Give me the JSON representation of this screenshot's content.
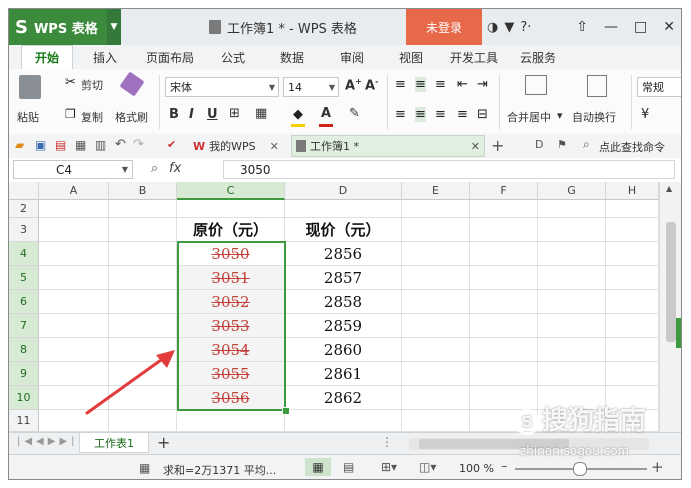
{
  "app": {
    "name": "WPS 表格",
    "logo_letter": "S",
    "doc_title": "工作簿1 * - WPS 表格",
    "login_label": "未登录"
  },
  "menu_tabs": [
    "开始",
    "插入",
    "页面布局",
    "公式",
    "数据",
    "审阅",
    "视图",
    "开发工具",
    "云服务"
  ],
  "ribbon": {
    "paste": "粘贴",
    "cut": "剪切",
    "copy": "复制",
    "format_painter": "格式刷",
    "font": "宋体",
    "font_size": "14",
    "merge_center": "合并居中",
    "wrap_text": "自动换行",
    "number_format": "常规"
  },
  "doc_tabs": {
    "my_wps": "我的WPS",
    "workbook": "工作簿1 *",
    "search": "点此查找命令"
  },
  "formula_bar": {
    "name_box": "C4",
    "fx": "fx",
    "value": "3050"
  },
  "columns": [
    "A",
    "B",
    "C",
    "D",
    "E",
    "F",
    "G",
    "H"
  ],
  "rows": [
    "2",
    "3",
    "4",
    "5",
    "6",
    "7",
    "8",
    "9",
    "10",
    "11"
  ],
  "table": {
    "header_original": "原价（元）",
    "header_current": "现价（元）",
    "original_prices": [
      "3050",
      "3051",
      "3052",
      "3053",
      "3054",
      "3055",
      "3056"
    ],
    "current_prices": [
      "2856",
      "2857",
      "2858",
      "2859",
      "2860",
      "2861",
      "2862"
    ]
  },
  "sheet": {
    "name": "工作表1",
    "add": "+"
  },
  "status": {
    "summary": "求和=2万1371  平均...",
    "zoom": "100 %",
    "zoom_minus": "–",
    "zoom_plus": "+"
  },
  "watermark": {
    "brand": "搜狗指南",
    "url": "zhinan.sogou.com"
  },
  "colors": {
    "accent": "#3c8a3c",
    "strike": "#c3403a",
    "arrow": "#e23b3b",
    "login": "#e8694a"
  }
}
